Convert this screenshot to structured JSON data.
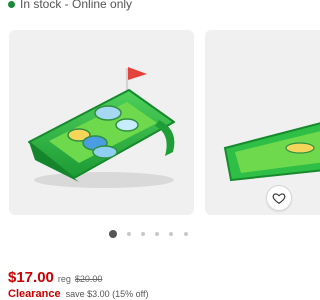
{
  "status": {
    "text": "In stock - Online only",
    "dot_color": "#1a8a3a"
  },
  "product": {
    "image_subject": "inflatable golf chipping float"
  },
  "carousel": {
    "slide_count": 7,
    "active_index": 0
  },
  "wishlist": {
    "icon": "heart-icon"
  },
  "pricing": {
    "price": "$17.00",
    "reg_label": "reg",
    "reg_price": "$20.00",
    "clearance_label": "Clearance",
    "savings": "save $3.00 (15% off)",
    "accent_color": "#cc0000"
  }
}
